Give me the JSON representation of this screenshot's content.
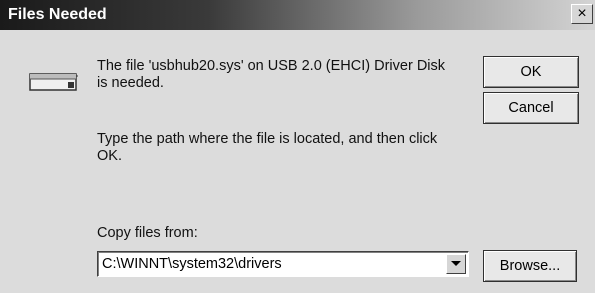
{
  "window": {
    "title": "Files Needed",
    "close_glyph": "×"
  },
  "icon": "disk-drive-icon",
  "message": {
    "line1": "The file 'usbhub20.sys' on USB 2.0 (EHCI) Driver Disk",
    "line2": "is needed.",
    "line3": "Type the path where the file is located, and then click",
    "line4": "OK."
  },
  "copy_from": {
    "label": "Copy files from:",
    "value": "C:\\WINNT\\system32\\drivers"
  },
  "buttons": {
    "ok": "OK",
    "cancel": "Cancel",
    "browse": "Browse..."
  }
}
